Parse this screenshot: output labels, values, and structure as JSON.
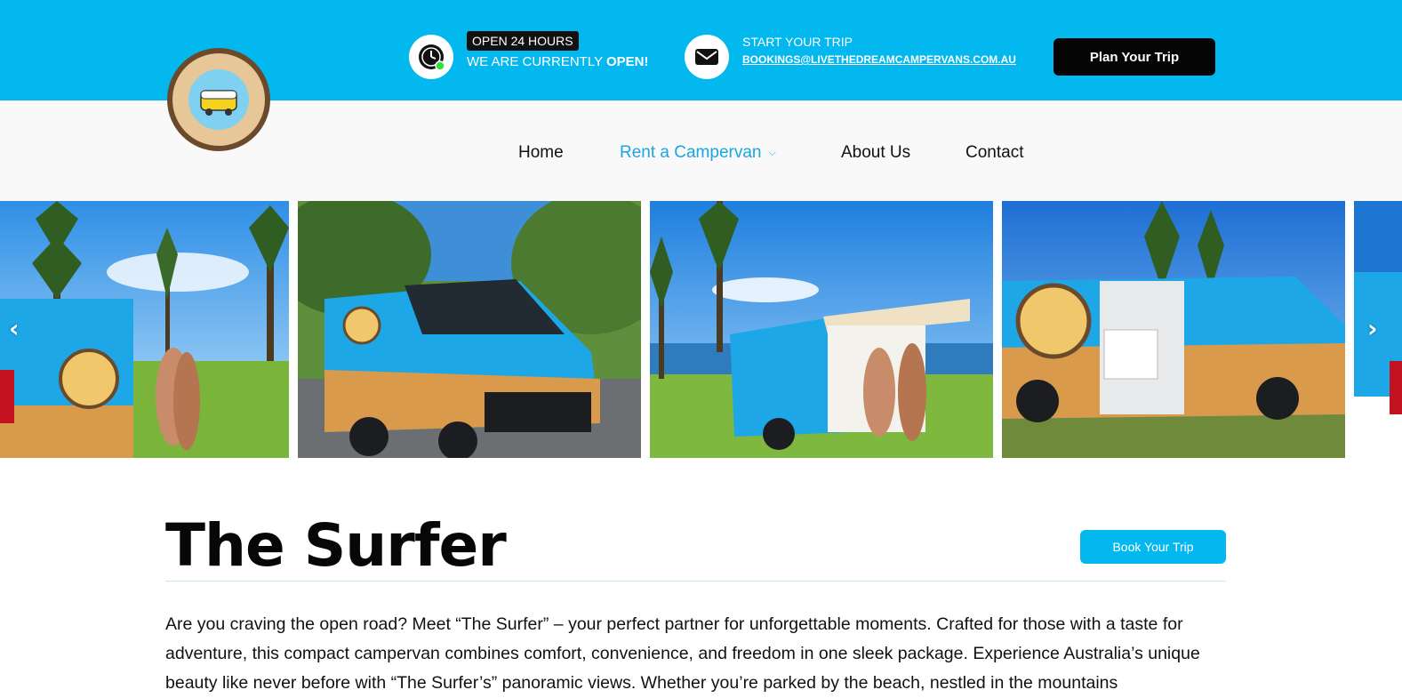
{
  "brand": {
    "logo_alt": "Live The Dreams Campervans logo"
  },
  "header": {
    "hours_badge": "OPEN 24 HOURS",
    "hours_status_prefix": "WE ARE CURRENTLY ",
    "hours_status_bold": "OPEN!",
    "trip_title": "START YOUR TRIP",
    "trip_email": "BOOKINGS@LIVETHEDREAMCAMPERVANS.COM.AU",
    "plan_button": "Plan Your Trip",
    "icons": [
      "clock-icon",
      "mail-icon"
    ]
  },
  "nav": {
    "items": [
      {
        "label": "Home",
        "active": false
      },
      {
        "label": "Rent a Campervan",
        "active": true,
        "dropdown": true
      },
      {
        "label": "About Us",
        "active": false
      },
      {
        "label": "Contact",
        "active": false
      }
    ]
  },
  "gallery": {
    "prev_arrow": "‹",
    "next_arrow": "›",
    "photos": [
      {
        "name": "photo-couple-by-van"
      },
      {
        "name": "photo-van-front-quarter"
      },
      {
        "name": "photo-van-open-tailgate"
      },
      {
        "name": "photo-van-side-door-open"
      },
      {
        "name": "photo-van-partial"
      }
    ]
  },
  "main": {
    "title": "The Surfer",
    "book_button": "Book Your Trip",
    "description": "Are you craving the open road? Meet “The Surfer” – your perfect partner for unforgettable moments. Crafted for those with a taste for adventure, this compact campervan combines comfort, convenience, and freedom in one sleek package. Experience Australia’s unique beauty like never before with “The Surfer’s” panoramic views. Whether you’re parked by the beach, nestled in the mountains"
  },
  "colors": {
    "accent": "#03b7ef",
    "nav_active": "#1aa6df",
    "button_dark": "#050505"
  }
}
